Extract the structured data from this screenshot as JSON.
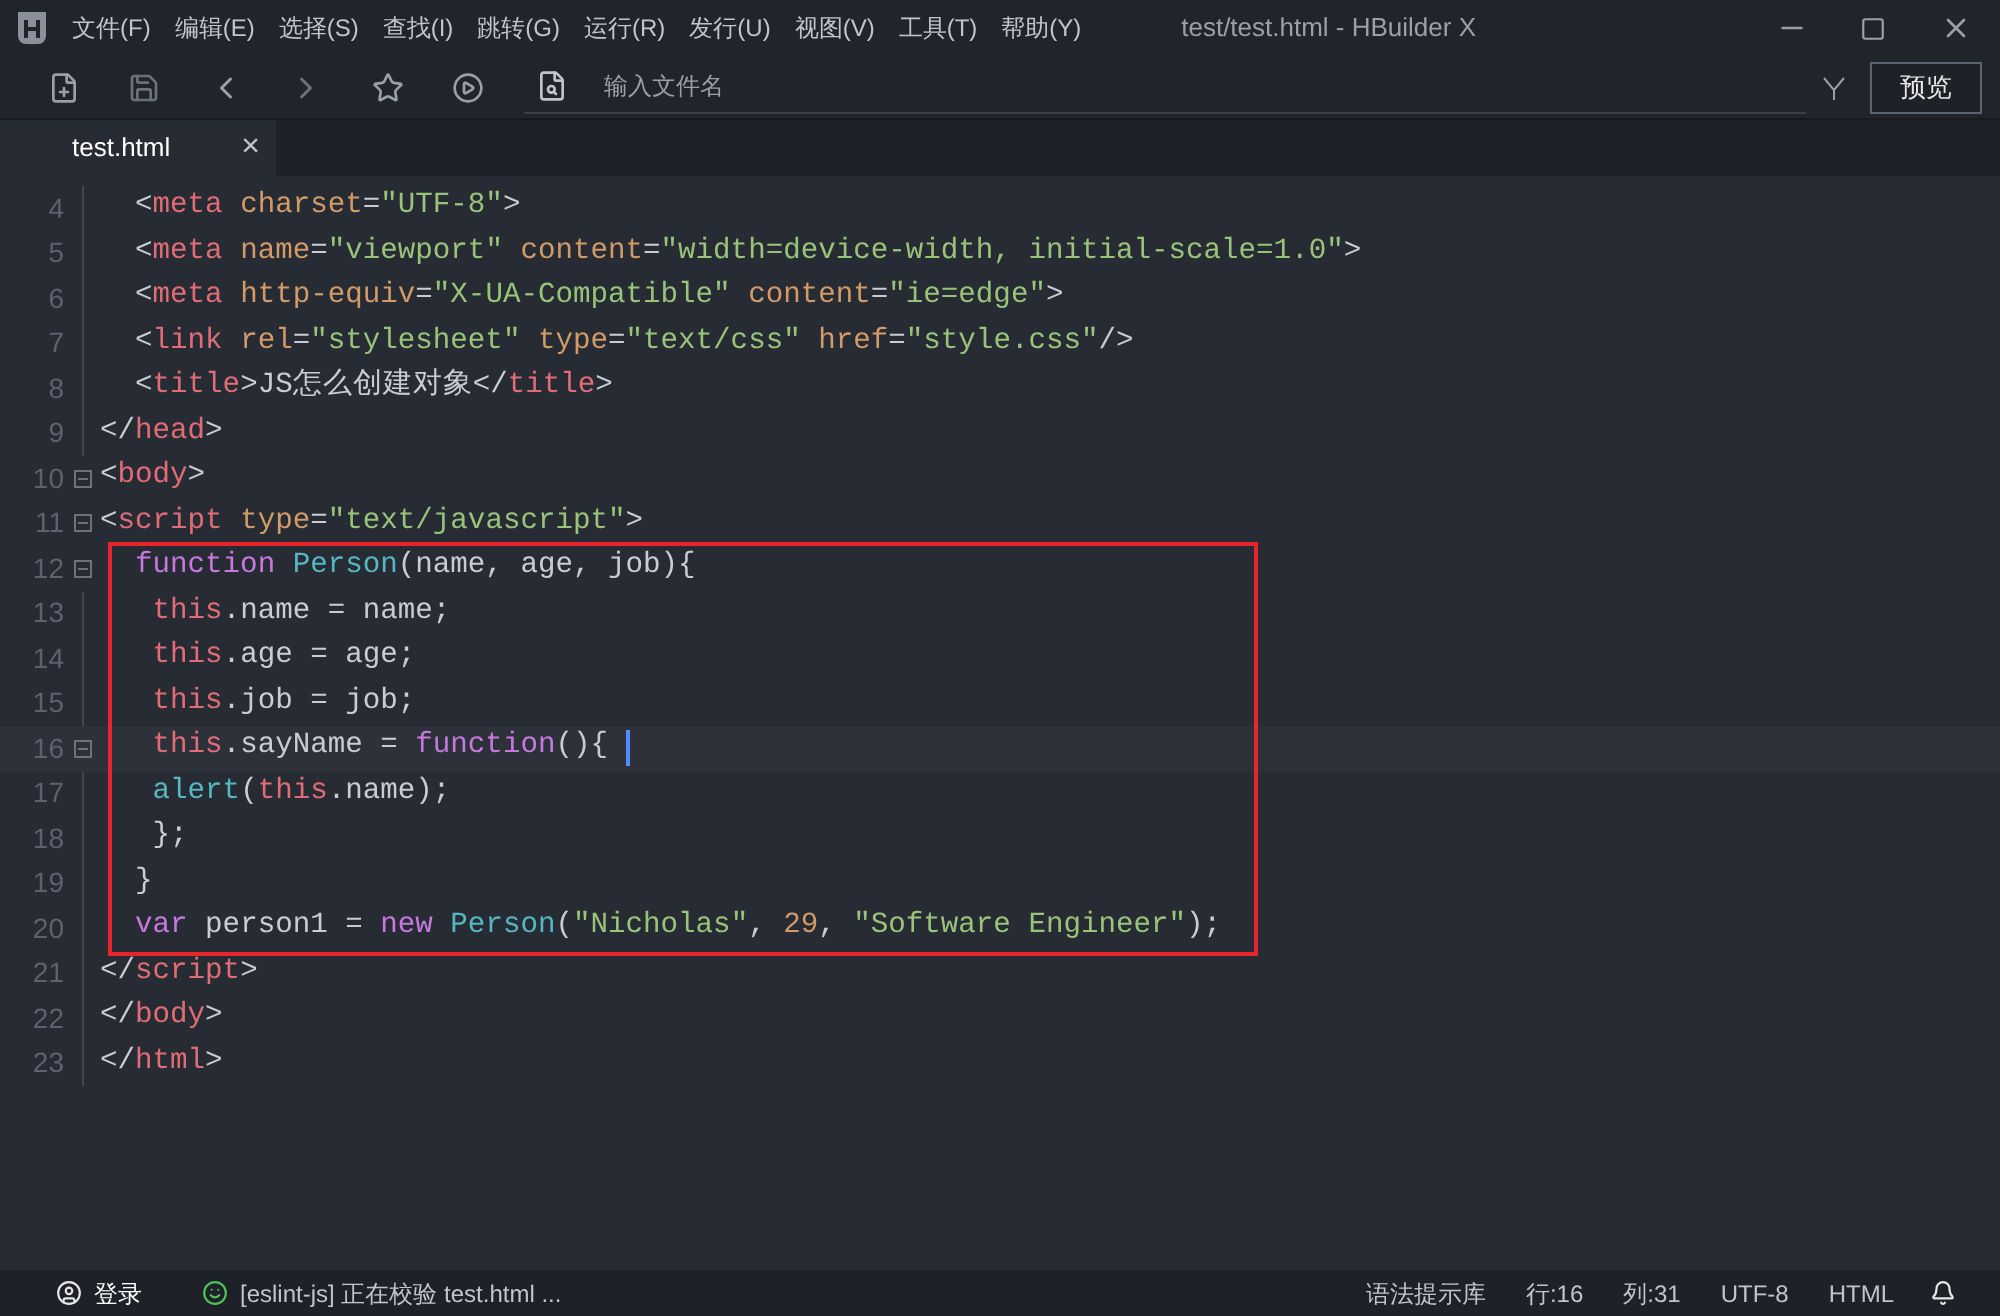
{
  "menu_bar": {
    "items": [
      "文件(F)",
      "编辑(E)",
      "选择(S)",
      "查找(I)",
      "跳转(G)",
      "运行(R)",
      "发行(U)",
      "视图(V)",
      "工具(T)",
      "帮助(Y)"
    ]
  },
  "window": {
    "title": "test/test.html - HBuilder X"
  },
  "toolbar": {
    "search": {
      "placeholder": "输入文件名"
    },
    "preview_button": "预览"
  },
  "tabs": [
    {
      "label": "test.html",
      "selected": true,
      "close": "×"
    }
  ],
  "editor": {
    "blocks": [
      {
        "boxed": false,
        "lines": [
          {
            "number": "4",
            "fold_toggle": false,
            "tokens": [
              {
                "kind": "plain",
                "text": "  <"
              },
              {
                "kind": "tag",
                "text": "meta"
              },
              {
                "kind": "attr",
                "text": " charset"
              },
              {
                "kind": "plain",
                "text": "="
              },
              {
                "kind": "string",
                "text": "\"UTF-8\""
              },
              {
                "kind": "plain",
                "text": ">"
              }
            ]
          },
          {
            "number": "5",
            "fold_toggle": false,
            "tokens": [
              {
                "kind": "plain",
                "text": "  <"
              },
              {
                "kind": "tag",
                "text": "meta"
              },
              {
                "kind": "attr",
                "text": " name"
              },
              {
                "kind": "plain",
                "text": "="
              },
              {
                "kind": "string",
                "text": "\"viewport\""
              },
              {
                "kind": "attr",
                "text": " content"
              },
              {
                "kind": "plain",
                "text": "="
              },
              {
                "kind": "string",
                "text": "\"width=device-width, initial-scale=1.0\""
              },
              {
                "kind": "plain",
                "text": ">"
              }
            ]
          },
          {
            "number": "6",
            "fold_toggle": false,
            "tokens": [
              {
                "kind": "plain",
                "text": "  <"
              },
              {
                "kind": "tag",
                "text": "meta"
              },
              {
                "kind": "attr",
                "text": " http-equiv"
              },
              {
                "kind": "plain",
                "text": "="
              },
              {
                "kind": "string",
                "text": "\"X-UA-Compatible\""
              },
              {
                "kind": "attr",
                "text": " content"
              },
              {
                "kind": "plain",
                "text": "="
              },
              {
                "kind": "string",
                "text": "\"ie=edge\""
              },
              {
                "kind": "plain",
                "text": ">"
              }
            ]
          },
          {
            "number": "7",
            "fold_toggle": false,
            "tokens": [
              {
                "kind": "plain",
                "text": "  <"
              },
              {
                "kind": "tag",
                "text": "link"
              },
              {
                "kind": "attr",
                "text": " rel"
              },
              {
                "kind": "plain",
                "text": "="
              },
              {
                "kind": "string",
                "text": "\"stylesheet\""
              },
              {
                "kind": "attr",
                "text": " type"
              },
              {
                "kind": "plain",
                "text": "="
              },
              {
                "kind": "string",
                "text": "\"text/css\""
              },
              {
                "kind": "attr",
                "text": " href"
              },
              {
                "kind": "plain",
                "text": "="
              },
              {
                "kind": "string",
                "text": "\"style.css\""
              },
              {
                "kind": "plain",
                "text": "/>"
              }
            ]
          },
          {
            "number": "8",
            "fold_toggle": false,
            "tokens": [
              {
                "kind": "plain",
                "text": "  <"
              },
              {
                "kind": "tag",
                "text": "title"
              },
              {
                "kind": "plain",
                "text": ">JS怎么创建对象</"
              },
              {
                "kind": "tag",
                "text": "title"
              },
              {
                "kind": "plain",
                "text": ">"
              }
            ]
          },
          {
            "number": "9",
            "fold_toggle": false,
            "tokens": [
              {
                "kind": "plain",
                "text": "</"
              },
              {
                "kind": "tag",
                "text": "head"
              },
              {
                "kind": "plain",
                "text": ">"
              }
            ]
          },
          {
            "number": "10",
            "fold_toggle": true,
            "tokens": [
              {
                "kind": "plain",
                "text": "<"
              },
              {
                "kind": "tag",
                "text": "body"
              },
              {
                "kind": "plain",
                "text": ">"
              }
            ]
          },
          {
            "number": "11",
            "fold_toggle": true,
            "tokens": [
              {
                "kind": "plain",
                "text": "<"
              },
              {
                "kind": "tag",
                "text": "script"
              },
              {
                "kind": "attr",
                "text": " type"
              },
              {
                "kind": "plain",
                "text": "="
              },
              {
                "kind": "string",
                "text": "\"text/javascript\""
              },
              {
                "kind": "plain",
                "text": ">"
              }
            ]
          }
        ]
      },
      {
        "boxed": true,
        "lines": [
          {
            "number": "12",
            "fold_toggle": true,
            "tokens": [
              {
                "kind": "keyword",
                "text": "  function"
              },
              {
                "kind": "func",
                "text": " Person"
              },
              {
                "kind": "plain",
                "text": "(name, age, job){"
              }
            ]
          },
          {
            "number": "13",
            "fold_toggle": false,
            "tokens": [
              {
                "kind": "this",
                "text": "   this"
              },
              {
                "kind": "plain",
                "text": ".name = name;"
              }
            ]
          },
          {
            "number": "14",
            "fold_toggle": false,
            "tokens": [
              {
                "kind": "this",
                "text": "   this"
              },
              {
                "kind": "plain",
                "text": ".age = age;"
              }
            ]
          },
          {
            "number": "15",
            "fold_toggle": false,
            "tokens": [
              {
                "kind": "this",
                "text": "   this"
              },
              {
                "kind": "plain",
                "text": ".job = job;"
              }
            ]
          },
          {
            "number": "16",
            "fold_toggle": true,
            "cursor": true,
            "tokens": [
              {
                "kind": "this",
                "text": "   this"
              },
              {
                "kind": "plain",
                "text": ".sayName = "
              },
              {
                "kind": "keyword",
                "text": "function"
              },
              {
                "kind": "plain",
                "text": "(){ "
              }
            ]
          },
          {
            "number": "17",
            "fold_toggle": false,
            "tokens": [
              {
                "kind": "func",
                "text": "   alert"
              },
              {
                "kind": "plain",
                "text": "("
              },
              {
                "kind": "this",
                "text": "this"
              },
              {
                "kind": "plain",
                "text": ".name);"
              }
            ]
          },
          {
            "number": "18",
            "fold_toggle": false,
            "tokens": [
              {
                "kind": "plain",
                "text": "   };"
              }
            ]
          },
          {
            "number": "19",
            "fold_toggle": false,
            "tokens": [
              {
                "kind": "plain",
                "text": "  }"
              }
            ]
          },
          {
            "number": "20",
            "fold_toggle": false,
            "tokens": [
              {
                "kind": "keyword",
                "text": "  var"
              },
              {
                "kind": "plain",
                "text": " person1 = "
              },
              {
                "kind": "keyword",
                "text": "new"
              },
              {
                "kind": "func",
                "text": " Person"
              },
              {
                "kind": "plain",
                "text": "("
              },
              {
                "kind": "string",
                "text": "\"Nicholas\""
              },
              {
                "kind": "plain",
                "text": ", "
              },
              {
                "kind": "number",
                "text": "29"
              },
              {
                "kind": "plain",
                "text": ", "
              },
              {
                "kind": "string",
                "text": "\"Software Engineer\""
              },
              {
                "kind": "plain",
                "text": ");"
              }
            ]
          }
        ]
      },
      {
        "boxed": false,
        "lines": [
          {
            "number": "21",
            "fold_toggle": false,
            "tokens": [
              {
                "kind": "plain",
                "text": "</"
              },
              {
                "kind": "tag",
                "text": "script"
              },
              {
                "kind": "plain",
                "text": ">"
              }
            ]
          },
          {
            "number": "22",
            "fold_toggle": false,
            "tokens": [
              {
                "kind": "plain",
                "text": "</"
              },
              {
                "kind": "tag",
                "text": "body"
              },
              {
                "kind": "plain",
                "text": ">"
              }
            ]
          },
          {
            "number": "23",
            "fold_toggle": false,
            "tokens": [
              {
                "kind": "plain",
                "text": "</"
              },
              {
                "kind": "tag",
                "text": "html"
              },
              {
                "kind": "plain",
                "text": ">"
              }
            ]
          }
        ]
      }
    ]
  },
  "status_bar": {
    "login": "登录",
    "lint_message": "[eslint-js] 正在校验 test.html ...",
    "items": [
      "语法提示库",
      "行:16",
      "列:31",
      "UTF-8",
      "HTML"
    ]
  }
}
